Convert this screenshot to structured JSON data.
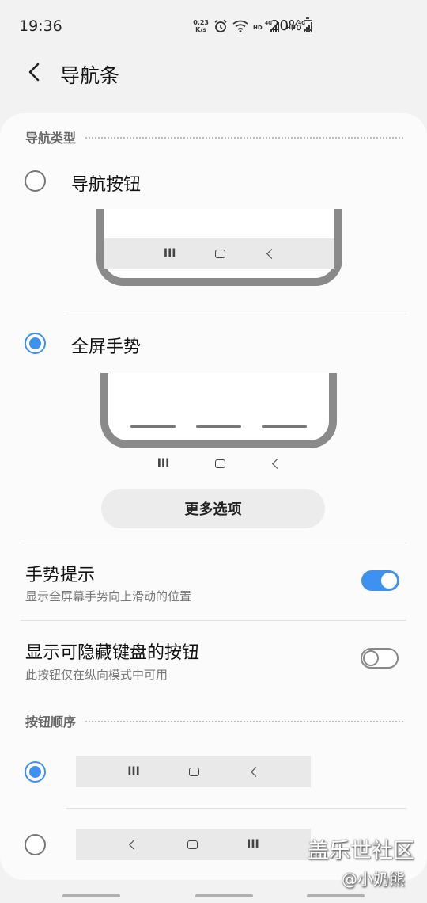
{
  "status_bar": {
    "time": "19:36",
    "net_speed_value": "0.23",
    "net_speed_unit": "K/s",
    "battery_text": "20%"
  },
  "header": {
    "title": "导航条"
  },
  "nav_type_section": {
    "header": "导航类型",
    "option_buttons": "导航按钮",
    "option_gestures": "全屏手势",
    "selected": "全屏手势"
  },
  "more_options": "更多选项",
  "gesture_hint": {
    "title": "手势提示",
    "subtitle": "显示全屏幕手势向上滑动的位置",
    "enabled": true
  },
  "hide_keyboard_button": {
    "title": "显示可隐藏键盘的按钮",
    "subtitle": "此按钮仅在纵向模式中可用",
    "enabled": false
  },
  "button_order_section": {
    "header": "按钮顺序",
    "options": [
      {
        "order": [
          "recent",
          "home",
          "back"
        ],
        "selected": true
      },
      {
        "order": [
          "back",
          "home",
          "recent"
        ],
        "selected": false
      }
    ]
  },
  "watermark": {
    "line1": "盖乐世社区",
    "line2": "@小奶熊"
  },
  "colors": {
    "accent": "#3e91ee",
    "background": "#f2f2f2",
    "card": "#fbfbfb"
  }
}
